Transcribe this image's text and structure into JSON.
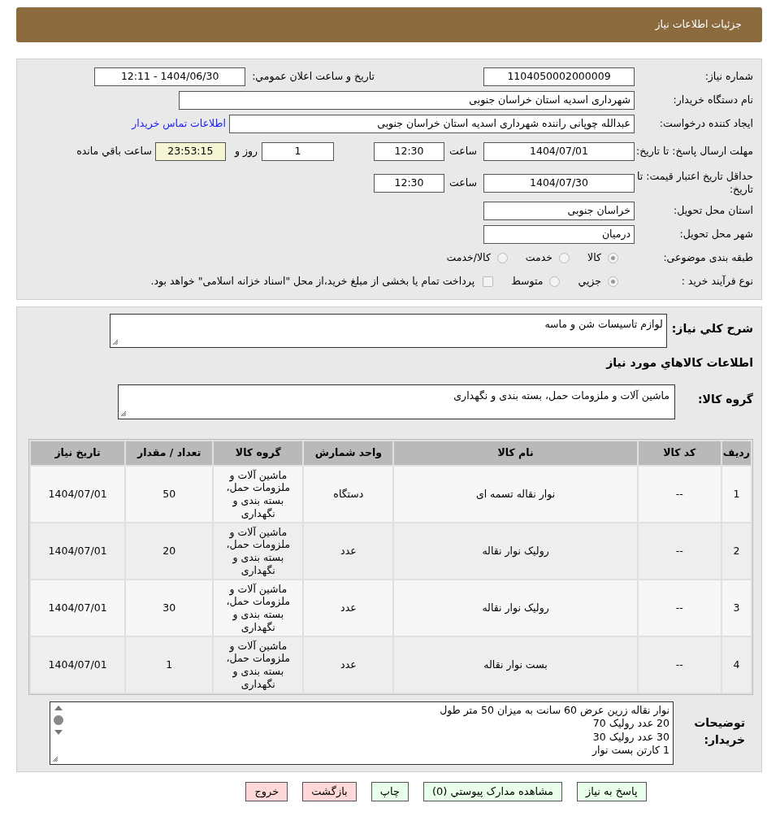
{
  "header": {
    "title": "جزئیات اطلاعات نیاز"
  },
  "details": {
    "need_number": {
      "label": "شماره نیاز:",
      "value": "1104050002000009"
    },
    "announce": {
      "label": "تاریخ و ساعت اعلان عمومي:",
      "value": "1404/06/30 - 12:11"
    },
    "buyer_org": {
      "label": "نام دستگاه خریدار:",
      "value": "شهرداری اسدیه استان خراسان جنوبی"
    },
    "requester": {
      "label": "ایجاد کننده درخواست:",
      "value": "عبدالله چوپانی راننده شهرداری اسدیه استان خراسان جنوبی",
      "link": "اطلاعات تماس خریدار"
    },
    "deadline": {
      "label": "مهلت ارسال پاسخ: تا تاریخ:",
      "date": "1404/07/01",
      "time_label": "ساعت",
      "time": "12:30",
      "days": "1",
      "days_label": "روز و",
      "remaining": "23:53:15",
      "remaining_label": "ساعت باقي مانده"
    },
    "validity": {
      "label": "حداقل تاریخ اعتبار قیمت: تا تاریخ:",
      "date": "1404/07/30",
      "time_label": "ساعت",
      "time": "12:30"
    },
    "province": {
      "label": "استان محل تحویل:",
      "value": "خراسان جنوبی"
    },
    "city": {
      "label": "شهر محل تحویل:",
      "value": "درمیان"
    },
    "category": {
      "label": "طبقه بندی موضوعی:",
      "options": [
        {
          "label": "كالا",
          "selected": true
        },
        {
          "label": "خدمت",
          "selected": false
        },
        {
          "label": "كالا/خدمت",
          "selected": false
        }
      ]
    },
    "process": {
      "label": "نوع فرآیند خرید :",
      "options": [
        {
          "label": "جزيي",
          "selected": true
        },
        {
          "label": "متوسط",
          "selected": false
        }
      ],
      "treasury": {
        "label": "پرداخت تمام یا بخشی از مبلغ خرید،از محل \"اسناد خزانه اسلامی\" خواهد بود.",
        "checked": false
      }
    }
  },
  "summary": {
    "label": "شرح كلي نياز:",
    "value": "لوازم تاسیسات شن و ماسه"
  },
  "goods_heading": "اطلاعات كالاهاي مورد نياز",
  "goods_group": {
    "label": "گروه کالا:",
    "value": "ماشین آلات و ملزومات حمل، بسته بندی و نگهداری"
  },
  "table": {
    "columns": [
      "ردیف",
      "کد کالا",
      "نام کالا",
      "واحد شمارش",
      "گروه کالا",
      "تعداد / مقدار",
      "تاریخ نیاز"
    ],
    "rows": [
      [
        "1",
        "--",
        "نوار نقاله تسمه ای",
        "دستگاه",
        "ماشین آلات و ملزومات حمل، بسته بندی و نگهداری",
        "50",
        "1404/07/01"
      ],
      [
        "2",
        "--",
        "رولیک نوار نقاله",
        "عدد",
        "ماشین آلات و ملزومات حمل، بسته بندی و نگهداری",
        "20",
        "1404/07/01"
      ],
      [
        "3",
        "--",
        "رولیک نوار نقاله",
        "عدد",
        "ماشین آلات و ملزومات حمل، بسته بندی و نگهداری",
        "30",
        "1404/07/01"
      ],
      [
        "4",
        "--",
        "بست نوار نقاله",
        "عدد",
        "ماشین آلات و ملزومات حمل، بسته بندی و نگهداری",
        "1",
        "1404/07/01"
      ]
    ]
  },
  "buyer_notes": {
    "label": "توضیحات خریدار:",
    "lines": [
      "نوار نقاله زرین عرض 60 سانت به میزان 50 متر طول",
      "20 عدد رولیک 70",
      "30 عدد رولیک 30",
      "1 کارتن بست نوار"
    ]
  },
  "buttons": [
    {
      "label": "پاسخ به نیاز",
      "color": "#eaffea"
    },
    {
      "label": "مشاهده مدارک پیوستي (0)",
      "color": "#eaffea"
    },
    {
      "label": "چاپ",
      "color": "#eaffea"
    },
    {
      "label": "بازگشت",
      "color": "#ffd9d9"
    },
    {
      "label": "خروج",
      "color": "#ffd9d9"
    }
  ]
}
